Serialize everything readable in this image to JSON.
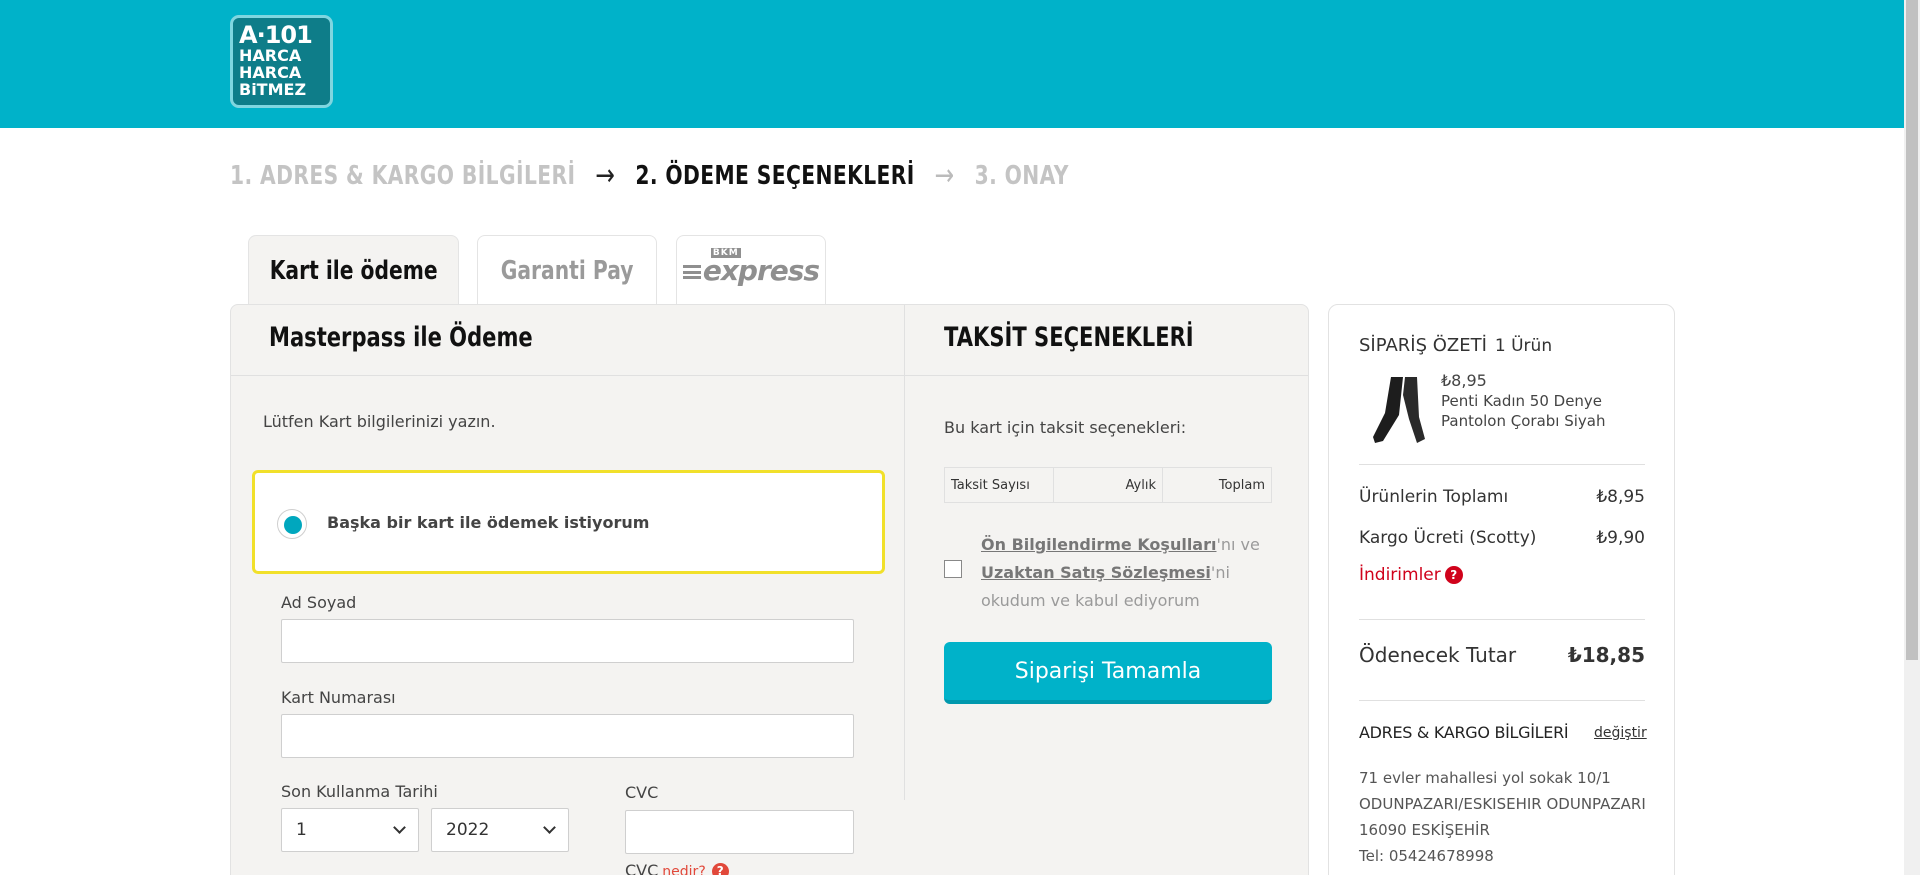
{
  "header": {
    "logo_lines": [
      "A·101",
      "HARCA",
      "HARCA",
      "BiTMEZ"
    ]
  },
  "steps": {
    "step1": "1. ADRES & KARGO BİLGİLERİ",
    "step2": "2. ÖDEME SEÇENEKLERİ",
    "step3": "3. ONAY",
    "arrow": "→",
    "active_index": 2
  },
  "tabs": [
    {
      "label": "Kart ile ödeme",
      "active": true
    },
    {
      "label": "Garanti Pay",
      "active": false
    },
    {
      "label": "express",
      "brand_mini": "BKM",
      "active": false
    }
  ],
  "masterpass": {
    "title": "Masterpass ile Ödeme",
    "instruction": "Lütfen Kart bilgilerinizi yazın.",
    "radio_label": "Başka bir kart ile ödemek istiyorum",
    "name_label": "Ad Soyad",
    "name_value": "",
    "card_label": "Kart Numarası",
    "card_value": "",
    "expiry_label": "Son Kullanma Tarihi",
    "expiry_month": "1",
    "expiry_year": "2022",
    "cvc_label": "CVC",
    "cvc_value": "",
    "cvc_question": "CVC",
    "cvc_link": "nedir?",
    "cvc_icon": "?"
  },
  "installments": {
    "title": "TAKSİT SEÇENEKLERİ",
    "subtitle": "Bu kart için taksit seçenekleri:",
    "columns": [
      "Taksit Sayısı",
      "Aylık",
      "Toplam"
    ],
    "agree_link1": "Ön Bilgilendirme Koşulları",
    "agree_mid": "'nı ve",
    "agree_link2": "Uzaktan Satış Sözleşmesi",
    "agree_end": "'ni okudum ve kabul ediyorum",
    "checked": false,
    "submit_label": "Siparişi Tamamla"
  },
  "summary": {
    "title": "SİPARİŞ ÖZETİ",
    "count": "1 Ürün",
    "product_price": "₺8,95",
    "product_name": "Penti Kadın 50 Denye Pantolon Çorabı Siyah",
    "products_total_label": "Ürünlerin Toplamı",
    "products_total": "₺8,95",
    "shipping_label": "Kargo Ücreti (Scotty)",
    "shipping": "₺9,90",
    "discounts_label": "İndirimler",
    "discounts_icon": "?",
    "payable_label": "Ödenecek Tutar",
    "payable": "₺18,85",
    "address_title": "ADRES & KARGO BİLGİLERİ",
    "address_edit": "değiştir",
    "address_lines": [
      "71 evler mahallesi yol sokak 10/1",
      "ODUNPAZARI/ESKISEHIR ODUNPAZARI",
      "16090 ESKİŞEHİR",
      "Tel: 05424678998"
    ]
  },
  "colors": {
    "brand": "#00b2c9",
    "highlight": "#f1e02a",
    "discount": "#d0021b"
  }
}
